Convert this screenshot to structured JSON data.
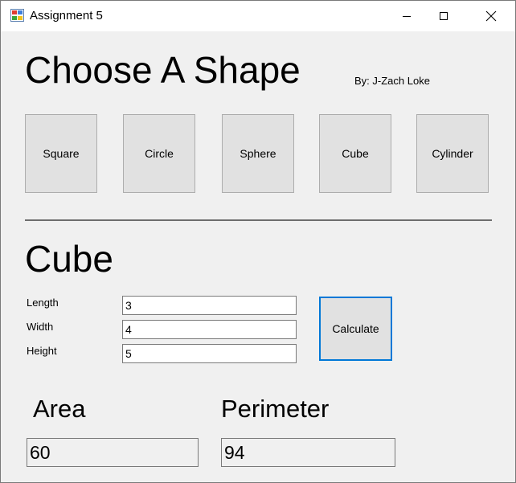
{
  "window": {
    "title": "Assignment 5",
    "controls": {
      "minimize": "minimize-icon",
      "maximize": "maximize-icon",
      "close": "close-icon"
    }
  },
  "header": {
    "title": "Choose A Shape",
    "byline": "By: J-Zach Loke"
  },
  "shape_buttons": [
    "Square",
    "Circle",
    "Sphere",
    "Cube",
    "Cylinder"
  ],
  "section": {
    "title": "Cube",
    "fields": [
      {
        "label": "Length",
        "value": "3"
      },
      {
        "label": "Width",
        "value": "4"
      },
      {
        "label": "Height",
        "value": "5"
      }
    ],
    "calculate_label": "Calculate"
  },
  "results": {
    "area_label": "Area",
    "area_value": "60",
    "perimeter_label": "Perimeter",
    "perimeter_value": "94"
  },
  "colors": {
    "window_bg": "#f0f0f0",
    "button_bg": "#e1e1e1",
    "focus_border": "#0078d7"
  }
}
